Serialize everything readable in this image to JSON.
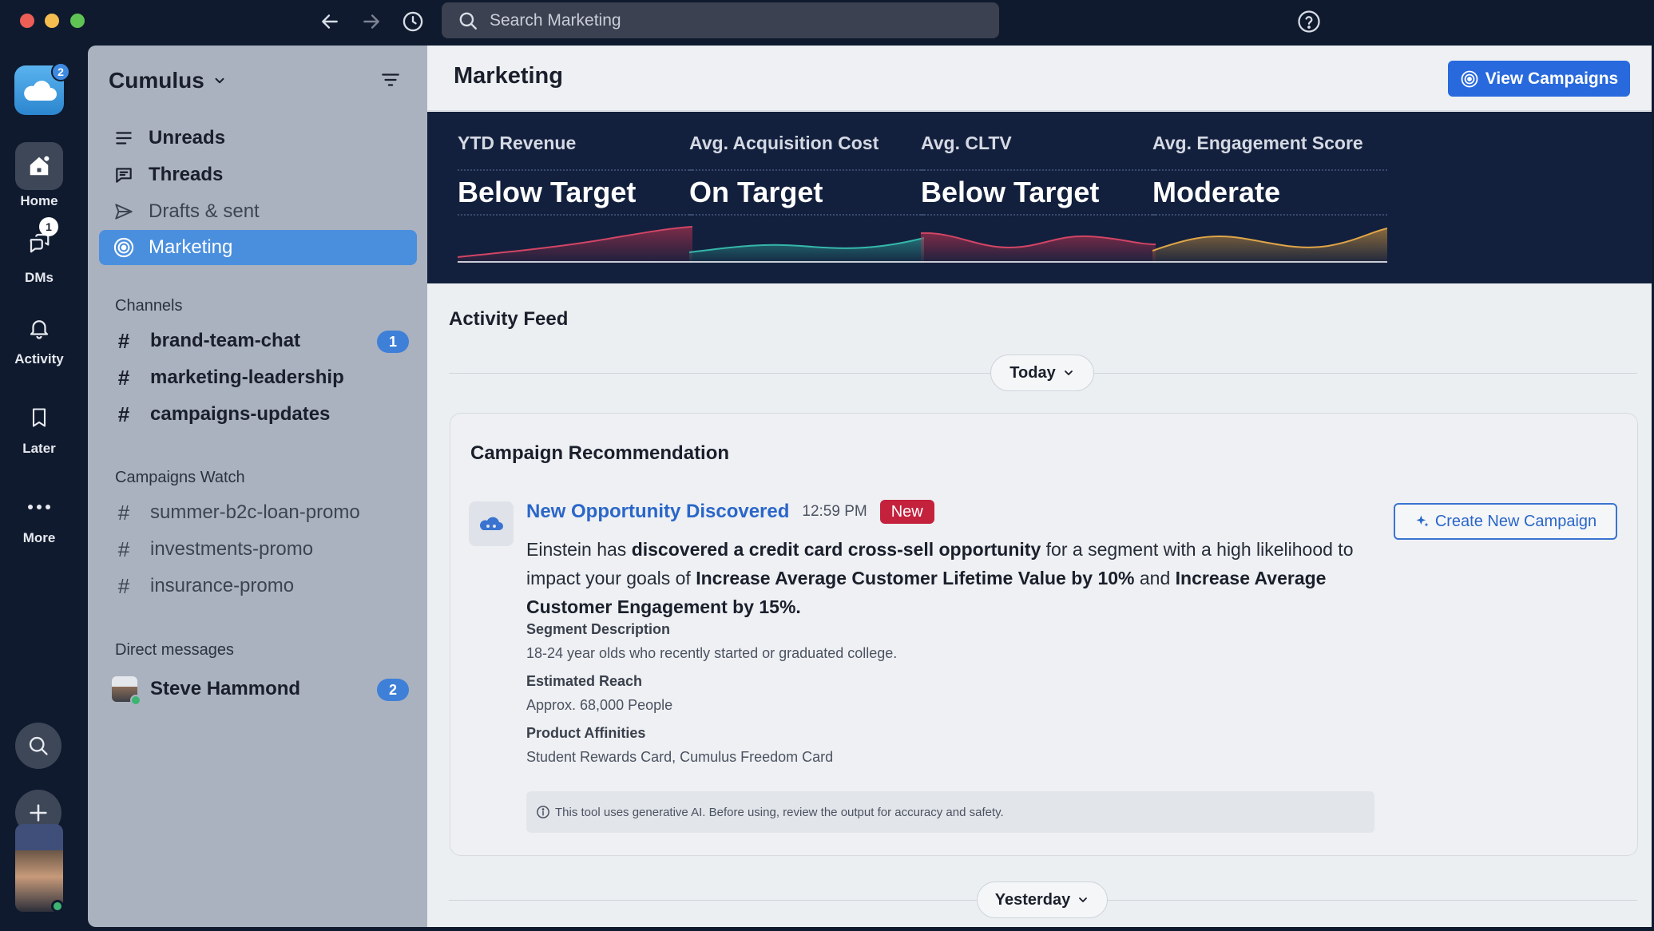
{
  "window": {
    "search_placeholder": "Search Marketing"
  },
  "rail": {
    "workspace_badge": "2",
    "items": [
      {
        "label": "Home"
      },
      {
        "label": "DMs",
        "badge": "1"
      },
      {
        "label": "Activity"
      },
      {
        "label": "Later"
      },
      {
        "label": "More"
      }
    ]
  },
  "sidebar": {
    "workspace": "Cumulus",
    "nav": [
      {
        "label": "Unreads"
      },
      {
        "label": "Threads"
      },
      {
        "label": "Drafts & sent"
      },
      {
        "label": "Marketing"
      }
    ],
    "channels_header": "Channels",
    "channels": [
      {
        "name": "brand-team-chat",
        "count": "1"
      },
      {
        "name": "marketing-leadership"
      },
      {
        "name": "campaigns-updates"
      }
    ],
    "campaigns_header": "Campaigns Watch",
    "campaigns": [
      {
        "name": "summer-b2c-loan-promo"
      },
      {
        "name": "investments-promo"
      },
      {
        "name": "insurance-promo"
      }
    ],
    "dm_header": "Direct messages",
    "dms": [
      {
        "name": "Steve Hammond",
        "count": "2"
      }
    ]
  },
  "main": {
    "title": "Marketing",
    "view_campaigns": "View Campaigns",
    "kpis": [
      {
        "label": "YTD Revenue",
        "value": "Below Target",
        "color": "#c0334f"
      },
      {
        "label": "Avg. Acquisition Cost",
        "value": "On Target",
        "color": "#2fa39a"
      },
      {
        "label": "Avg. CLTV",
        "value": "Below Target",
        "color": "#c0334f"
      },
      {
        "label": "Avg. Engagement Score",
        "value": "Moderate",
        "color": "#d79a3c"
      }
    ],
    "feed_title": "Activity Feed",
    "day_today": "Today",
    "day_yesterday": "Yesterday",
    "card": {
      "title": "Campaign Recommendation",
      "msg_title": "New Opportunity Discovered",
      "time": "12:59 PM",
      "badge": "New",
      "create_button": "Create New Campaign",
      "body": {
        "p1": "Einstein has ",
        "b1": "discovered a credit card cross-sell opportunity",
        "p2": " for a segment with a high likelihood to impact your goals of ",
        "b2": "Increase Average Customer Lifetime Value by 10%",
        "p3": " and ",
        "b3": "Increase Average Customer Engagement by 15%.",
        "p4": ""
      },
      "fields": [
        {
          "label": "Segment Description",
          "value": "18-24 year olds who recently started or graduated college."
        },
        {
          "label": "Estimated Reach",
          "value": "Approx. 68,000 People"
        },
        {
          "label": "Product Affinities",
          "value": "Student Rewards Card, Cumulus Freedom Card"
        }
      ],
      "ai_note": "This tool uses generative AI. Before using, review the output for accuracy and safety."
    }
  }
}
